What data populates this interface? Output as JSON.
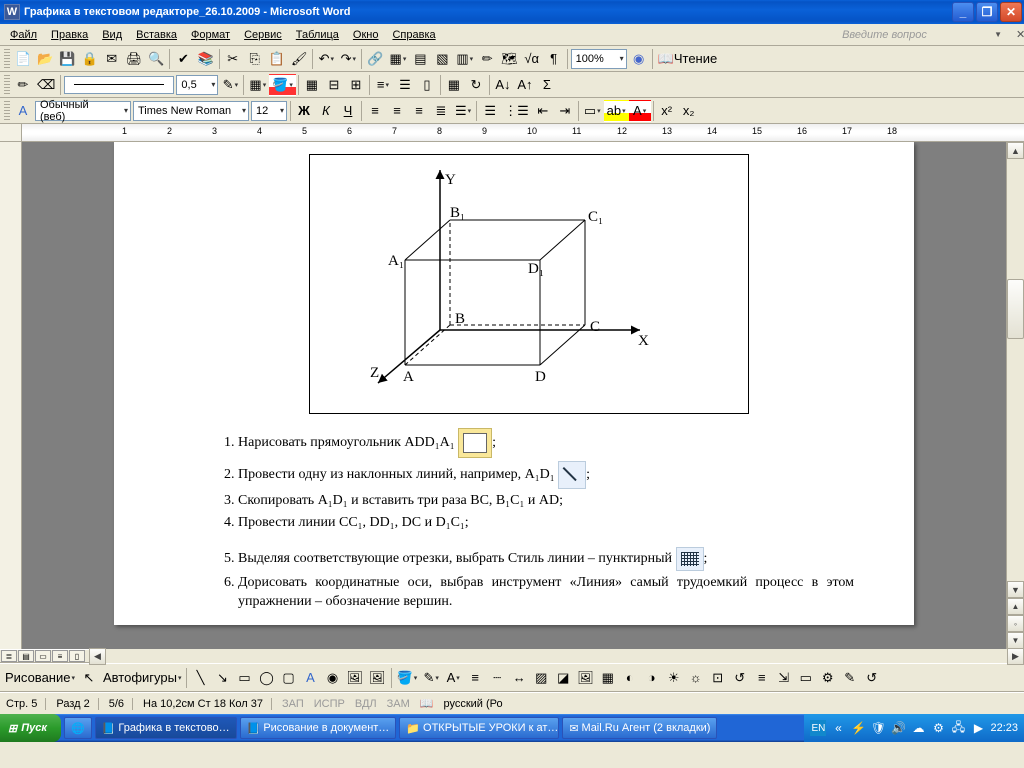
{
  "window": {
    "title": "Графика в текстовом редакторе_26.10.2009 - Microsoft Word",
    "app_letter": "W"
  },
  "menu": {
    "file": "Файл",
    "edit": "Правка",
    "view": "Вид",
    "insert": "Вставка",
    "format": "Формат",
    "tools": "Сервис",
    "table": "Таблица",
    "window": "Окно",
    "help": "Справка",
    "ask_placeholder": "Введите вопрос"
  },
  "toolbar": {
    "zoom": "100%",
    "read": "Чтение",
    "style": "Обычный (веб)",
    "font": "Times New Roman",
    "size": "12",
    "line_width": "0,5",
    "autoshapes": "Автофигуры",
    "drawing": "Рисование"
  },
  "diagram": {
    "axes": {
      "x": "X",
      "y": "Y",
      "z": "Z"
    },
    "pts": {
      "A": "A",
      "B": "B",
      "C": "C",
      "D": "D",
      "A1": "A₁",
      "B1": "B₁",
      "C1": "C₁",
      "D1": "D₁"
    }
  },
  "doc": {
    "li1_a": "Нарисовать прямоугольник ADD₁A₁ ",
    "li1_b": ";",
    "li2_a": "Провести одну из наклонных линий, например, A₁D₁ ",
    "li2_b": ";",
    "li3": "Скопировать A₁D₁ и вставить три раза BC, B₁C₁ и AD;",
    "li4": "Провести линии CC₁, DD₁, DC и D₁C₁;",
    "li5_a": "Выделяя соответствующие отрезки, выбрать Стиль линии – пунктирный ",
    "li5_b": ";",
    "li6": "Дорисовать координатные оси, выбрав инструмент «Линия» самый трудоемкий процесс в этом упражнении – обозначение вершин."
  },
  "ruler": {
    "n1": "1",
    "n2": "2",
    "n3": "3",
    "n4": "4",
    "n5": "5",
    "n6": "6",
    "n7": "7",
    "n8": "8",
    "n9": "9",
    "n10": "10",
    "n11": "11",
    "n12": "12",
    "n13": "13",
    "n14": "14",
    "n15": "15",
    "n16": "16",
    "n17": "17",
    "n18": "18"
  },
  "status": {
    "page": "Стр. 5",
    "section": "Разд 2",
    "pages": "5/6",
    "pos": "На 10,2см Ст 18 Кол 37",
    "rec": "ЗАП",
    "trk": "ИСПР",
    "ext": "ВДЛ",
    "ovr": "ЗАМ",
    "lang": "русский (Ро"
  },
  "taskbar": {
    "start": "Пуск",
    "t1": "Графика в текстово…",
    "t2": "Рисование в документ…",
    "t3": "ОТКРЫТЫЕ УРОКИ к ат…",
    "t4": "Mail.Ru Агент (2 вкладки)",
    "lang": "EN",
    "arrows": "«",
    "time": "22:23"
  }
}
